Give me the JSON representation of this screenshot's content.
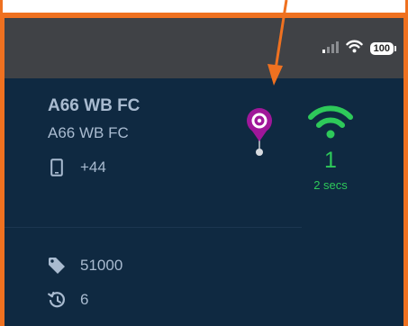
{
  "status_bar": {
    "battery_level": "100",
    "icons": [
      "signal-bars-icon",
      "wifi-icon",
      "battery-icon"
    ]
  },
  "device": {
    "name": "A66 WB FC",
    "label": "A66 WB FC",
    "phone": "+44",
    "tag": "51000",
    "history": "6"
  },
  "connection": {
    "count": "1",
    "last_seen": "2 secs"
  },
  "colors": {
    "annotation": "#ef7120",
    "status_bar": "#404246",
    "background": "#0f2941",
    "text": "#a9bbd0",
    "online": "#2ec95a",
    "pin": "#a0179a"
  }
}
